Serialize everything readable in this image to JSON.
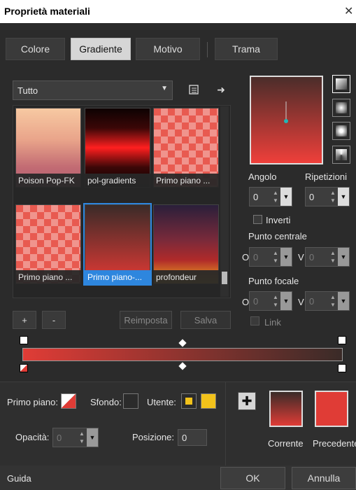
{
  "window": {
    "title": "Proprietà materiali",
    "close_icon": "close-icon"
  },
  "tabs": [
    {
      "label": "Colore",
      "active": false
    },
    {
      "label": "Gradiente",
      "active": true
    },
    {
      "label": "Motivo",
      "active": false
    },
    {
      "label": "Trama",
      "active": false
    }
  ],
  "category": {
    "selected": "Tutto"
  },
  "gradients": [
    {
      "label": "Poison Pop-FK",
      "selected": false
    },
    {
      "label": "pol-gradients",
      "selected": false
    },
    {
      "label": "Primo piano ...",
      "selected": false
    },
    {
      "label": "Primo piano ...",
      "selected": false
    },
    {
      "label": "Primo piano-...",
      "selected": true
    },
    {
      "label": "profondeur",
      "selected": false
    }
  ],
  "list_buttons": {
    "add": "+",
    "remove": "-",
    "reset": "Reimposta",
    "save": "Salva"
  },
  "properties": {
    "angle_label": "Angolo",
    "angle_value": "0",
    "repeat_label": "Ripetizioni",
    "repeat_value": "0",
    "invert_label": "Inverti",
    "center_label": "Punto centrale",
    "center_o_label": "O",
    "center_o_value": "0",
    "center_v_label": "V",
    "center_v_value": "0",
    "focal_label": "Punto focale",
    "focal_o_label": "O",
    "focal_o_value": "0",
    "focal_v_label": "V",
    "focal_v_value": "0",
    "link_label": "Link"
  },
  "colors": {
    "foreground_label": "Primo piano:",
    "background_label": "Sfondo:",
    "user_label": "Utente:",
    "opacity_label": "Opacità:",
    "opacity_value": "0",
    "position_label": "Posizione:",
    "position_value": "0",
    "current_label": "Corrente",
    "previous_label": "Precedente",
    "gradient_start": "#e03c36",
    "gradient_end": "#3a2b28",
    "user_color": "#f2c21b"
  },
  "footer": {
    "help": "Guida",
    "ok": "OK",
    "cancel": "Annulla"
  }
}
